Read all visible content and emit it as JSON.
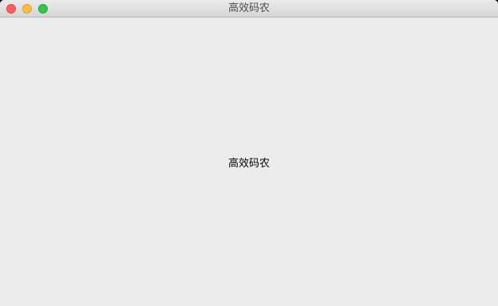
{
  "window": {
    "title": "高效码农"
  },
  "content": {
    "label": "高效码农"
  },
  "colors": {
    "close": "#fc605c",
    "minimize": "#fdbc40",
    "zoom": "#34c84a",
    "background": "#ececec"
  }
}
